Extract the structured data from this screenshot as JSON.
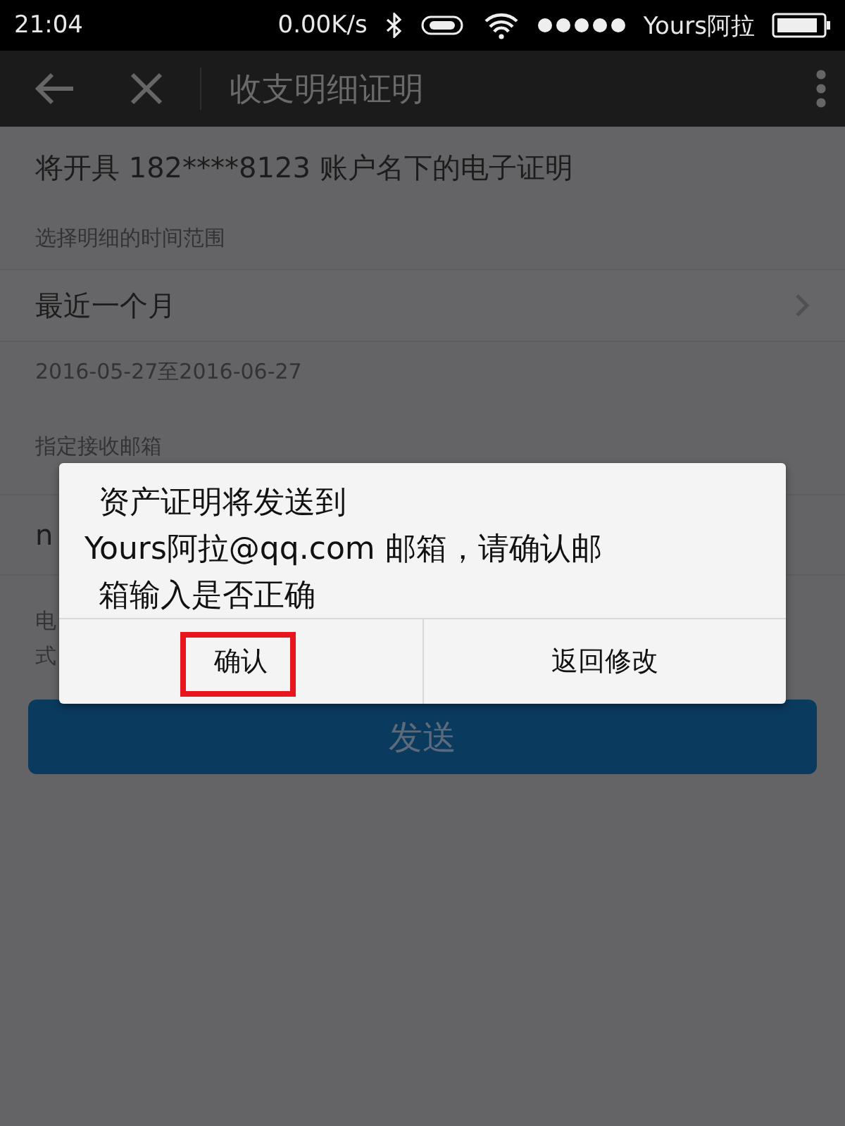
{
  "status_bar": {
    "time": "21:04",
    "speed": "0.00K/s",
    "carrier": "Yours阿拉"
  },
  "app_bar": {
    "title": "收支明细证明"
  },
  "intro": "将开具 182****8123 账户名下的电子证明",
  "range_label": "选择明细的时间范围",
  "range_value": "最近一个月",
  "range_dates": "2016-05-27至2016-06-27",
  "email_label": "指定接收邮箱",
  "email_value": "n",
  "note_lines": [
    "电",
    "式"
  ],
  "send_button": "发送",
  "dialog": {
    "message_lines": [
      "资产证明将发送到",
      "Yours阿拉@qq.com 邮箱，请确认邮",
      "箱输入是否正确"
    ],
    "buttons": [
      {
        "label": "确认",
        "highlighted": true
      },
      {
        "label": "返回修改",
        "highlighted": false
      }
    ]
  }
}
